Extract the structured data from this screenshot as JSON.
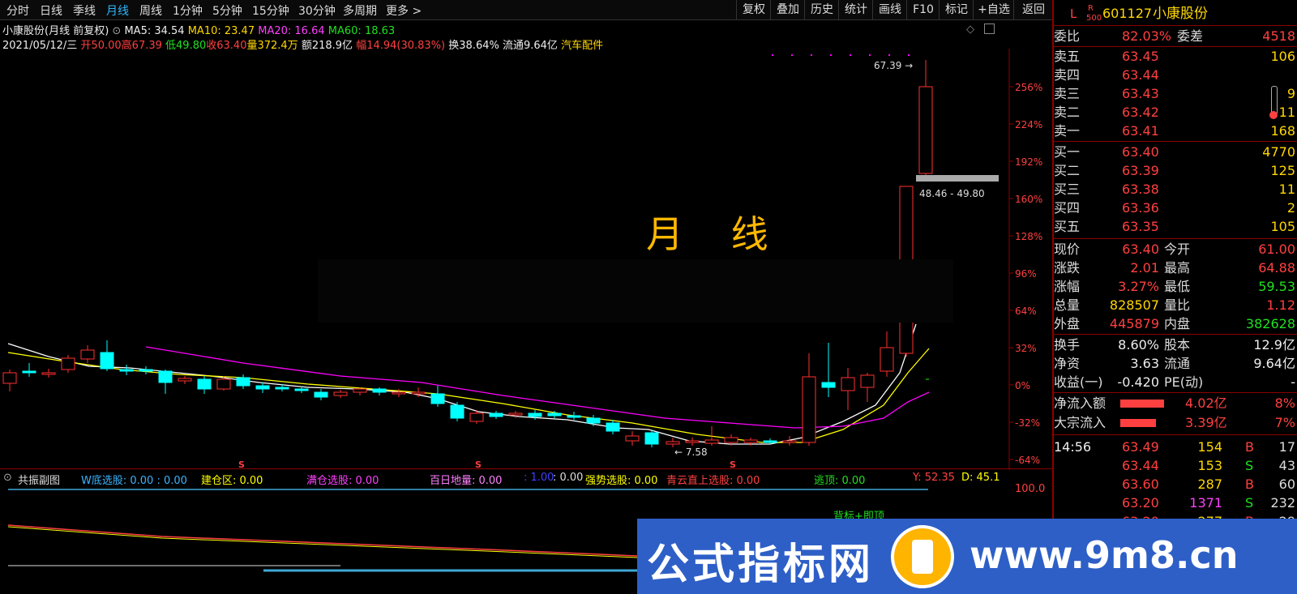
{
  "toolbar": {
    "tabs": [
      "分时",
      "日线",
      "季线",
      "月线",
      "周线",
      "1分钟",
      "5分钟",
      "15分钟",
      "30分钟",
      "多周期",
      "更多 >"
    ],
    "active": "月线",
    "right_buttons": [
      "复权",
      "叠加",
      "历史",
      "统计",
      "画线",
      "F10",
      "标记",
      "+自选",
      "返回"
    ]
  },
  "header": {
    "stock_label": "小康股份(月线 前复权)",
    "ma5": "MA5: 34.54",
    "ma10": "MA10: 23.47",
    "ma20": "MA20: 16.64",
    "ma60": "MA60: 18.63",
    "date": "2021/05/12/三",
    "open": "开50.00",
    "high": "高67.39",
    "low": "低49.80",
    "close": "收63.40",
    "vol": "量372.4万",
    "amount": "额218.9亿",
    "range": "幅14.94(30.83%)",
    "turnover": "换38.64%",
    "float": "流通9.64亿",
    "industry": "汽车配件"
  },
  "chart": {
    "watermark": "月 线",
    "y_labels": [
      "256%",
      "224%",
      "192%",
      "160%",
      "128%",
      "96%",
      "64%",
      "32%",
      "0%",
      "-32%",
      "-64%"
    ],
    "max_label": "67.39",
    "min_label": "7.58",
    "gap_label": "48.46 - 49.80",
    "s_marker": "S",
    "colors": {
      "up": "#ff3030",
      "down": "#00ffff",
      "ma5": "#ffffff",
      "ma10": "#ffff00",
      "ma20": "#ff00ff",
      "ma60": "#00ff00"
    }
  },
  "sub_panel": {
    "title": "共振副图",
    "w_bottom": "W底选股: 0.00 : 0.00",
    "build": "建仓区: 0.00",
    "full": "满仓选股: 0.00",
    "hundred": "百日地量: 0.00",
    "blue": ": 1.00",
    "zero": ": 0.00",
    "strong": "强势选股: 0.00",
    "cloud": "青云直上选股: 0.00",
    "escape": "逃顶: 0.00",
    "y": "Y: 52.35",
    "d": "D: 45.1",
    "scale": "100.0",
    "note": "背标+即顶"
  },
  "quote": {
    "prefix_l": "L",
    "prefix_r": "R",
    "prefix_500": "500",
    "code": "601127",
    "name": "小康股份",
    "weibi_label": "委比",
    "weibi": "82.03%",
    "weicha_label": "委差",
    "weicha": "4518",
    "asks": [
      {
        "label": "卖五",
        "price": "63.45",
        "vol": "106"
      },
      {
        "label": "卖四",
        "price": "63.44",
        "vol": ""
      },
      {
        "label": "卖三",
        "price": "63.43",
        "vol": "9"
      },
      {
        "label": "卖二",
        "price": "63.42",
        "vol": "11"
      },
      {
        "label": "卖一",
        "price": "63.41",
        "vol": "168"
      }
    ],
    "bids": [
      {
        "label": "买一",
        "price": "63.40",
        "vol": "4770"
      },
      {
        "label": "买二",
        "price": "63.39",
        "vol": "125"
      },
      {
        "label": "买三",
        "price": "63.38",
        "vol": "11"
      },
      {
        "label": "买四",
        "price": "63.36",
        "vol": "2"
      },
      {
        "label": "买五",
        "price": "63.35",
        "vol": "105"
      }
    ],
    "stats": [
      {
        "l1": "现价",
        "v1": "63.40",
        "c1": "red",
        "l2": "今开",
        "v2": "61.00",
        "c2": "red"
      },
      {
        "l1": "涨跌",
        "v1": "2.01",
        "c1": "red",
        "l2": "最高",
        "v2": "64.88",
        "c2": "red"
      },
      {
        "l1": "涨幅",
        "v1": "3.27%",
        "c1": "red",
        "l2": "最低",
        "v2": "59.53",
        "c2": "grn"
      },
      {
        "l1": "总量",
        "v1": "828507",
        "c1": "yel",
        "l2": "量比",
        "v2": "1.12",
        "c2": "red"
      },
      {
        "l1": "外盘",
        "v1": "445879",
        "c1": "red",
        "l2": "内盘",
        "v2": "382628",
        "c2": "grn"
      }
    ],
    "stats2": [
      {
        "l1": "换手",
        "v1": "8.60%",
        "c1": "wht",
        "l2": "股本",
        "v2": "12.9亿",
        "c2": "wht"
      },
      {
        "l1": "净资",
        "v1": "3.63",
        "c1": "wht",
        "l2": "流通",
        "v2": "9.64亿",
        "c2": "wht"
      },
      {
        "l1": "收益(一)",
        "v1": "-0.420",
        "c1": "wht",
        "l2": "PE(动)",
        "v2": "-",
        "c2": "wht"
      }
    ],
    "flow": [
      {
        "label": "净流入额",
        "val": "4.02亿",
        "pct": "8%"
      },
      {
        "label": "大宗流入",
        "val": "3.39亿",
        "pct": "7%"
      }
    ],
    "ticks": [
      {
        "time": "14:56",
        "price": "63.49",
        "vol": "154",
        "side": "B",
        "n": "17"
      },
      {
        "time": "",
        "price": "63.44",
        "vol": "153",
        "side": "S",
        "n": "43"
      },
      {
        "time": "",
        "price": "63.60",
        "vol": "287",
        "side": "B",
        "n": "60"
      },
      {
        "time": "",
        "price": "63.20",
        "vol": "1371",
        "side": "S",
        "n": "232"
      },
      {
        "time": "",
        "price": "63.20",
        "vol": "277",
        "side": "B",
        "n": "29"
      }
    ]
  },
  "banner": {
    "left_text": "公式指标网",
    "right_text": "www.9m8.cn"
  }
}
